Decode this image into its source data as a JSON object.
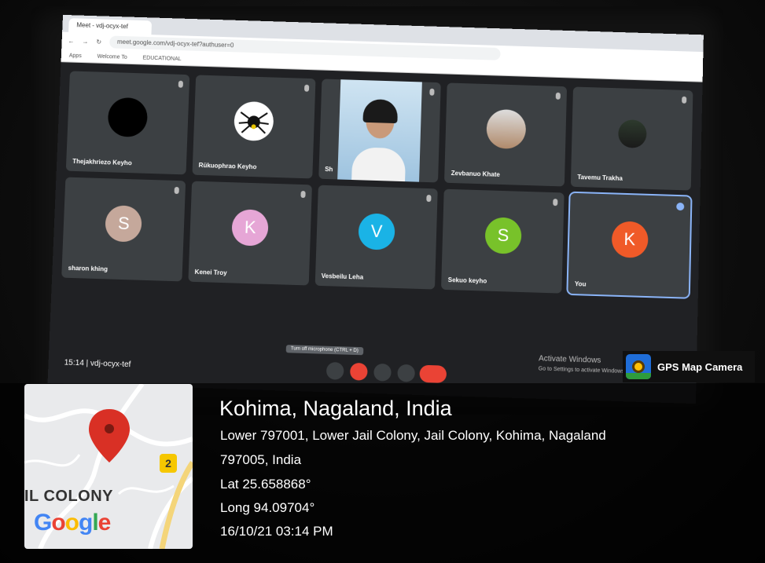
{
  "meet": {
    "code_line": "15:14  |  vdj-ocyx-tef",
    "tooltip": "Turn off microphone (CTRL + D)",
    "activate_title": "Activate Windows",
    "activate_sub": "Go to Settings to activate Windows."
  },
  "participants": [
    {
      "name": "Thejakhriezo Keyho",
      "type": "dark"
    },
    {
      "name": "Rükuophrao Keyho",
      "type": "spider"
    },
    {
      "name": "Sh",
      "type": "video"
    },
    {
      "name": "Zevbanuo Khate",
      "type": "photo"
    },
    {
      "name": "Tavemu Trakha",
      "type": "photo2"
    },
    {
      "name": "sharon khing",
      "initial": "S",
      "color": "#c5a89b"
    },
    {
      "name": "Kenei Troy",
      "initial": "K",
      "color": "#e6a6d6"
    },
    {
      "name": "Vesbeilu Leha",
      "initial": "V",
      "color": "#1ab3e6"
    },
    {
      "name": "Sekuo keyho",
      "initial": "S",
      "color": "#78c22a"
    },
    {
      "name": "You",
      "initial": "K",
      "color": "#f05a28"
    }
  ],
  "gps": {
    "app_name": "GPS Map Camera",
    "title": "Kohima, Nagaland, India",
    "address_line1": "Lower 797001, Lower Jail Colony, Jail Colony, Kohima, Nagaland",
    "address_line2": "797005, India",
    "lat": "Lat 25.658868°",
    "long": "Long 94.09704°",
    "datetime": "16/10/21 03:14 PM"
  },
  "map": {
    "area_label": "IL COLONY",
    "brand": "Google",
    "road_badge": "2",
    "pin_color": "#d93025"
  }
}
